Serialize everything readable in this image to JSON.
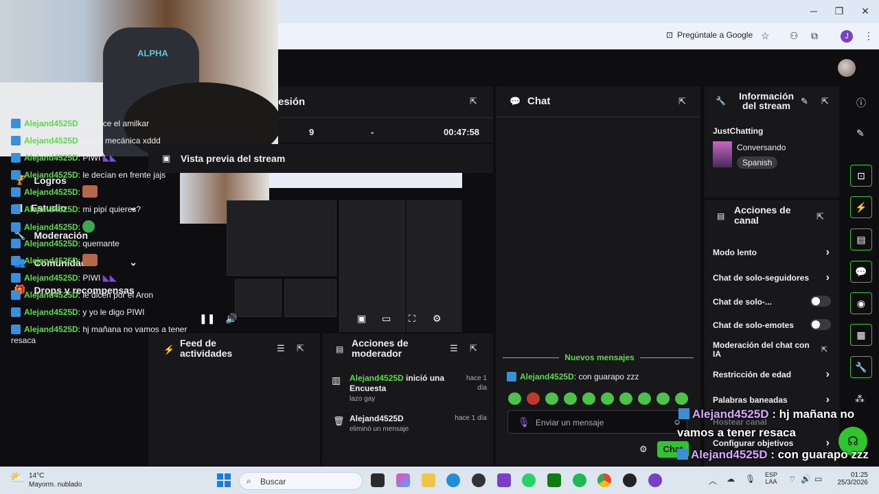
{
  "browser": {
    "ask_google": "Pregúntale a Google",
    "profile_initial": "J"
  },
  "session": {
    "title": "esión",
    "stat_1": "9",
    "stat_2": "-",
    "time": "00:47:58"
  },
  "nav": {
    "items": [
      {
        "label": "Logros",
        "icon": "trophy-icon"
      },
      {
        "label": "Estudio",
        "icon": "studio-icon",
        "expandable": true
      },
      {
        "label": "Moderación",
        "icon": "wrench-icon"
      },
      {
        "label": "Comunidad",
        "icon": "community-icon",
        "expandable": true
      },
      {
        "label": "Drops y recompensas",
        "icon": "drops-icon"
      }
    ]
  },
  "preview": {
    "title": "Vista previa del stream"
  },
  "feed": {
    "title": "Feed de actividades"
  },
  "mod_actions": {
    "title": "Acciones de moderador",
    "entries": [
      {
        "user": "Alejand4525D",
        "action": " inició una Encuesta",
        "detail": "lazo gay",
        "time": "hace 1 día"
      },
      {
        "user": "Alejand4525D",
        "action": "",
        "detail": "eliminó un mensaje",
        "time": "hace 1 día"
      }
    ]
  },
  "chat": {
    "title": "Chat",
    "messages": [
      {
        "user": "Alejand4525D",
        "text": ": ahí dice el amilkar"
      },
      {
        "user": "Alejand4525D",
        "text": ": tecno mecánica xddd"
      },
      {
        "user": "Alejand4525D",
        "text": ": PIWI"
      },
      {
        "user": "Alejand4525D",
        "text": ": le decían en frente jajs"
      },
      {
        "user": "Alejand4525D",
        "text": ":"
      },
      {
        "user": "Alejand4525D",
        "text": ": mi pipí quieres?"
      },
      {
        "user": "Alejand4525D",
        "text": ":"
      },
      {
        "user": "Alejand4525D",
        "text": ": quemante"
      },
      {
        "user": "Alejand4525D",
        "text": ":"
      },
      {
        "user": "Alejand4525D",
        "text": ": PIWI"
      },
      {
        "user": "Alejand4525D",
        "text": ": le dicen por el Aron"
      },
      {
        "user": "Alejand4525D",
        "text": ": y yo le digo PIWI"
      },
      {
        "user": "Alejand4525D",
        "text": ": hj mañana no vamos a tener resaca"
      }
    ],
    "new_messages_label": "Nuevos mensajes",
    "new_message": {
      "user": "Alejand4525D",
      "text": ": con guarapo zzz"
    },
    "input_placeholder": "Enviar un mensaje",
    "send_label": "Chat"
  },
  "stream_info": {
    "title": "Información del stream",
    "category": "JustChatting",
    "stream_title": "Conversando",
    "tag": "Spanish"
  },
  "channel_actions": {
    "title": "Acciones de canal",
    "items": [
      {
        "label": "Modo lento",
        "control": "arrow"
      },
      {
        "label": "Chat de solo-seguidores",
        "control": "arrow"
      },
      {
        "label": "Chat de solo-...",
        "control": "toggle"
      },
      {
        "label": "Chat de solo-emotes",
        "control": "toggle"
      },
      {
        "label": "Moderación del chat con IA",
        "control": "external"
      },
      {
        "label": "Restricción de edad",
        "control": "arrow"
      },
      {
        "label": "Palabras baneadas",
        "control": "arrow"
      },
      {
        "label": "Hostear canal",
        "control": "none"
      },
      {
        "label": "Configurar objetivos",
        "control": "arrow"
      }
    ]
  },
  "overlay": {
    "line1_user": "Alejand4525D",
    "line1_text": " : hj mañana no",
    "line2_text": "vamos a tener resaca",
    "line3_user": "Alejand4525D",
    "line3_text": " : con guarapo zzz"
  },
  "taskbar": {
    "weather_temp": "14°C",
    "weather_desc": "Mayorm. nublado",
    "search_label": "Buscar",
    "lang": "ESP",
    "lang_sub": "LAA",
    "time": "01:25",
    "date": "25/3/2026"
  },
  "colors": {
    "accent_green": "#5bdb4b",
    "twitch_bg": "#0e0e10",
    "panel_bg": "#18181b",
    "chat_button": "#2ec52e"
  }
}
